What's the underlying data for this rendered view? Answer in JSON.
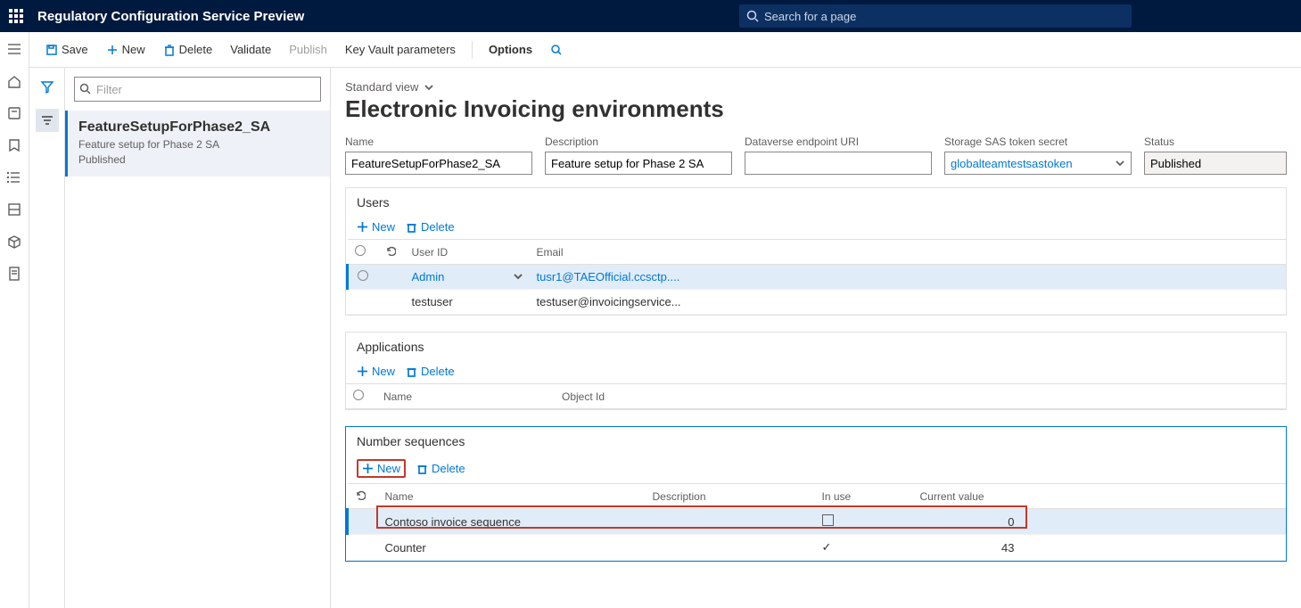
{
  "topbar": {
    "title": "Regulatory Configuration Service Preview",
    "search_placeholder": "Search for a page"
  },
  "cmd": {
    "save": "Save",
    "new": "New",
    "delete": "Delete",
    "validate": "Validate",
    "publish": "Publish",
    "keyvault": "Key Vault parameters",
    "options": "Options"
  },
  "list": {
    "filter_placeholder": "Filter",
    "item": {
      "title": "FeatureSetupForPhase2_SA",
      "line1": "Feature setup for Phase 2 SA",
      "line2": "Published"
    }
  },
  "view": "Standard view",
  "page_title": "Electronic Invoicing environments",
  "fields": {
    "name_label": "Name",
    "name_value": "FeatureSetupForPhase2_SA",
    "desc_label": "Description",
    "desc_value": "Feature setup for Phase 2 SA",
    "dv_label": "Dataverse endpoint URI",
    "dv_value": "",
    "sas_label": "Storage SAS token secret",
    "sas_value": "globalteamtestsastoken",
    "status_label": "Status",
    "status_value": "Published"
  },
  "gridcmd": {
    "new": "New",
    "delete": "Delete"
  },
  "users": {
    "title": "Users",
    "col_user": "User ID",
    "col_email": "Email",
    "rows": [
      {
        "user": "Admin",
        "email": "tusr1@TAEOfficial.ccsctp....",
        "selected": true
      },
      {
        "user": "testuser",
        "email": "testuser@invoicingservice...",
        "selected": false
      }
    ]
  },
  "apps": {
    "title": "Applications",
    "col_name": "Name",
    "col_obj": "Object Id"
  },
  "seq": {
    "title": "Number sequences",
    "col_name": "Name",
    "col_desc": "Description",
    "col_inuse": "In use",
    "col_curr": "Current value",
    "rows": [
      {
        "name": "Contoso invoice sequence",
        "desc": "",
        "inuse": false,
        "curr": "0",
        "selected": true
      },
      {
        "name": "Counter",
        "desc": "",
        "inuse": true,
        "curr": "43",
        "selected": false
      }
    ]
  }
}
